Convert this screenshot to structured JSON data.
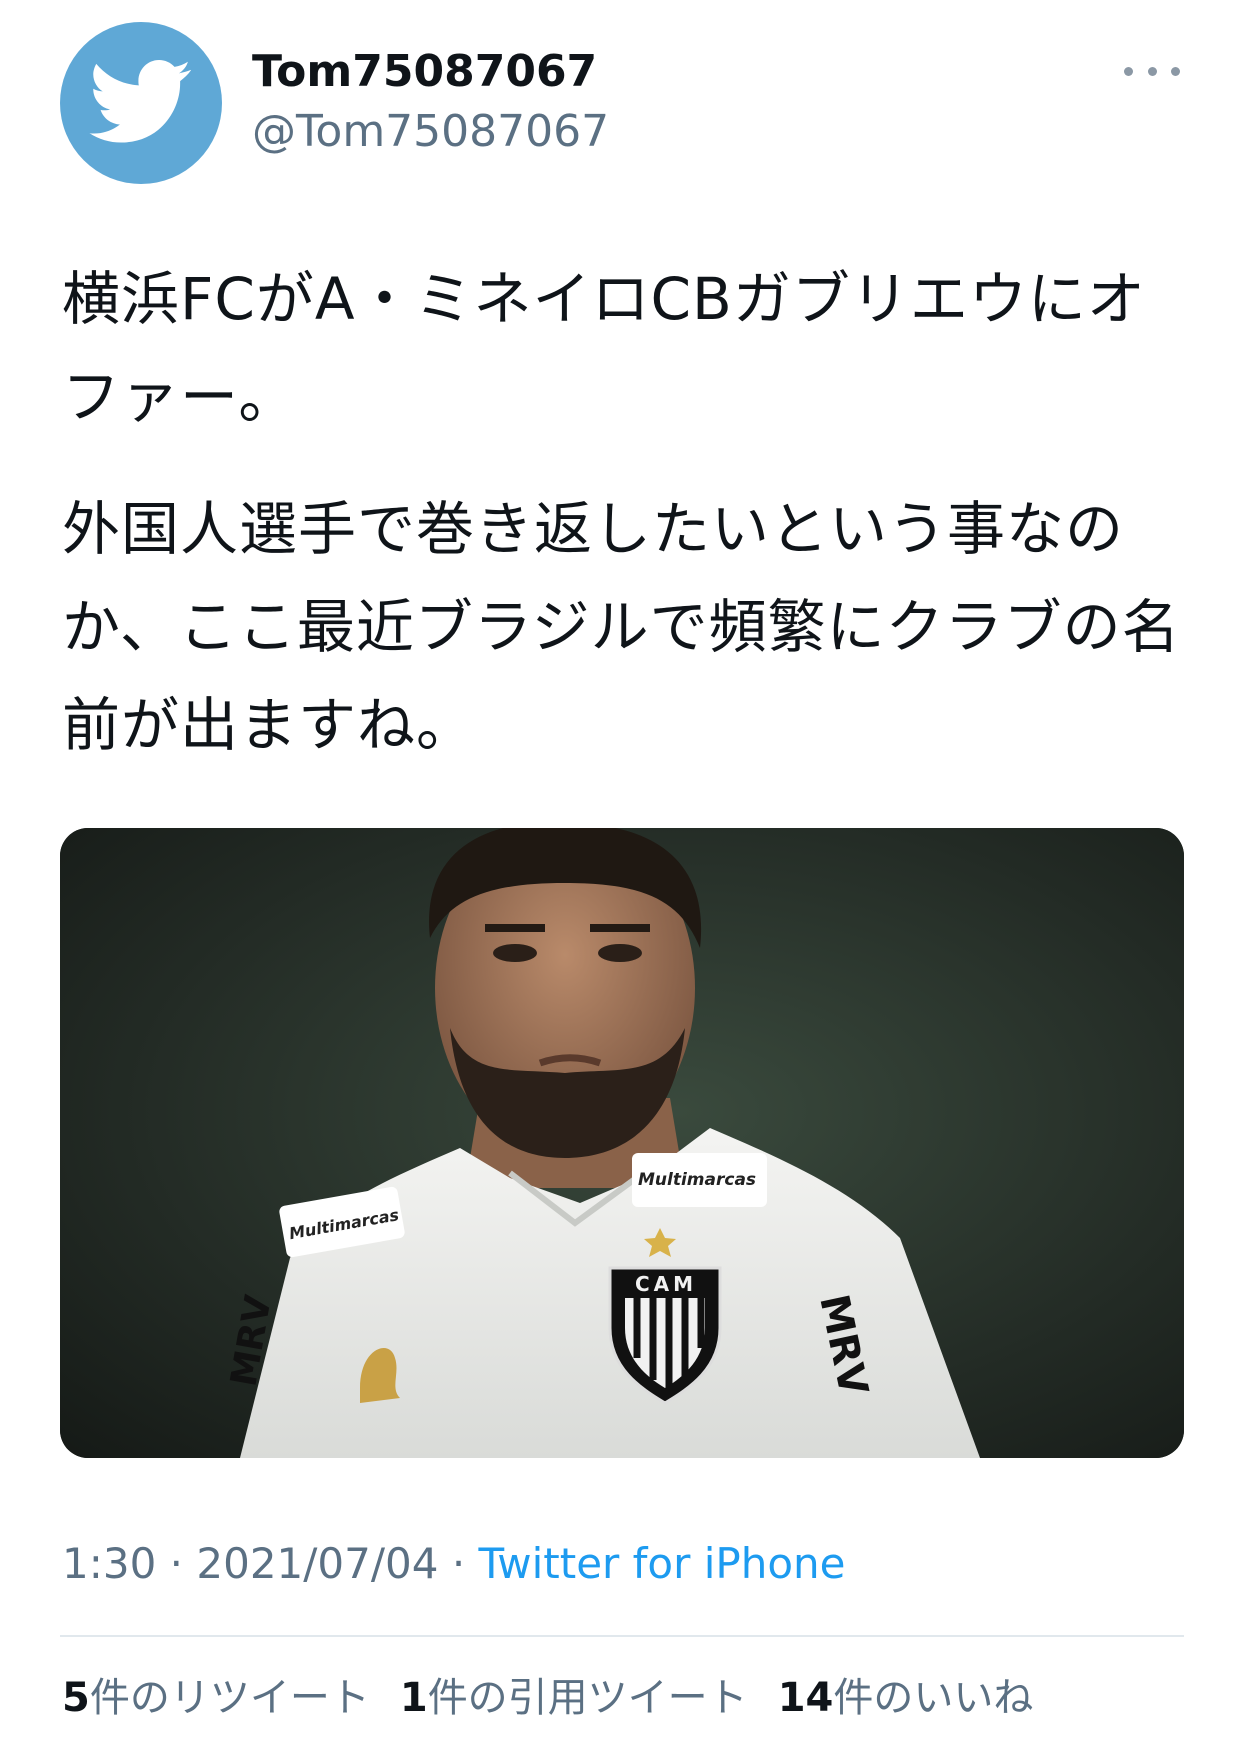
{
  "user": {
    "display_name": "Tom75087067",
    "handle": "@Tom75087067",
    "avatar_icon": "twitter-bird-icon",
    "avatar_color": "#5fa8d6"
  },
  "more_icon": "more-icon",
  "tweet": {
    "paragraphs": [
      "横浜FCがA・ミネイロCBガブリエウにオファー。",
      "外国人選手で巻き返したいという事なのか、ここ最近ブラジルで頻繁にクラブの名前が出ますね。"
    ]
  },
  "media": {
    "jersey_sponsor_text": "Multimarcas",
    "crest_text": "CAM",
    "side_text": "MRV"
  },
  "meta": {
    "time": "1:30",
    "sep1": " · ",
    "date": "2021/07/04",
    "sep2": " · ",
    "source": "Twitter for iPhone"
  },
  "stats": {
    "retweets_count": "5",
    "retweets_label": "件のリツイート",
    "quotes_count": "1",
    "quotes_label": "件の引用ツイート",
    "likes_count": "14",
    "likes_label": "件のいいね"
  },
  "colors": {
    "link": "#1d9bf0",
    "secondary_text": "#5b7083"
  }
}
